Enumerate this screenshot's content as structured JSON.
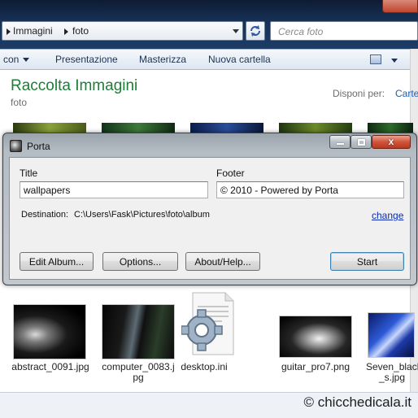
{
  "explorer": {
    "breadcrumb": [
      "Immagini",
      "foto"
    ],
    "search_placeholder": "Cerca foto",
    "toolbar": [
      "con",
      "Presentazione",
      "Masterizza",
      "Nuova cartella"
    ],
    "library_title": "Raccolta Immagini",
    "library_subtitle": "foto",
    "arrange_label": "Disponi per:",
    "arrange_value": "Carte",
    "files": [
      {
        "name": "abstract_0091.jpg"
      },
      {
        "name": "computer_0083.jpg"
      },
      {
        "name": "desktop.ini"
      },
      {
        "name": "guitar_pro7.png"
      },
      {
        "name": "Seven_black_s.jpg"
      }
    ]
  },
  "dialog": {
    "title": "Porta",
    "close_glyph": "x",
    "title_field_label": "Title",
    "title_field_value": "wallpapers",
    "footer_field_label": "Footer",
    "footer_field_value": "© 2010 - Powered by Porta",
    "destination_label": "Destination:",
    "destination_path": "C:\\Users\\Fask\\Pictures\\foto\\album",
    "change_link": "change",
    "buttons": {
      "edit_album": "Edit Album...",
      "options": "Options...",
      "about": "About/Help...",
      "start": "Start"
    }
  },
  "watermark": "© chicchedicala.it"
}
